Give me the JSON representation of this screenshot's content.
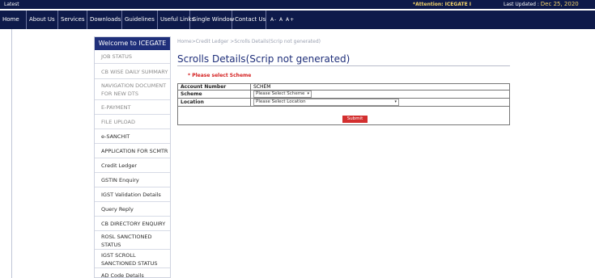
{
  "topbar": {
    "latest": "Latest",
    "attention": "*Attention: ICEGATE I",
    "last_updated_label": "Last Updated :",
    "last_updated_date": "Dec 25, 2020"
  },
  "nav": {
    "items": [
      "Home",
      "About Us",
      "Services",
      "Downloads",
      "Guidelines",
      "Useful Links",
      "Single Window",
      "Contact Us"
    ],
    "font_controls": "A- A A+"
  },
  "sidebar": {
    "welcome": "Welcome to ICEGATE",
    "items": [
      "JOB STATUS",
      "CB WISE DAILY SUMMARY",
      "NAVIGATION DOCUMENT FOR NEW DTS",
      "E-PAYMENT",
      "FILE UPLOAD",
      "e-SANCHIT",
      "APPLICATION FOR SCMTR",
      "Credit Ledger",
      "GSTIN Enquiry",
      "IGST Validation Details",
      "Query Reply",
      "CB DIRECTORY ENQUIRY",
      "ROSL SANCTIONED STATUS",
      "IGST SCROLL SANCTIONED STATUS",
      "AD Code Details"
    ]
  },
  "breadcrumb": "Home>Credit Ledger >Scrolls Details(Scrip not generated)",
  "page_title": "Scrolls Details(Scrip not generated)",
  "required_msg": "* Please select Scheme",
  "form": {
    "account_number_label": "Account Number",
    "account_number_value": "SCHEM",
    "scheme_label": "Scheme",
    "scheme_value": "Please Select Scheme",
    "location_label": "Location",
    "location_value": "Please Select Location",
    "submit_label": "Submit"
  },
  "colors": {
    "nav_bg": "#0e1a4a",
    "sidebar_header": "#1f2f7a",
    "submit_bg": "#d32f2f",
    "required": "#d41f1f"
  }
}
